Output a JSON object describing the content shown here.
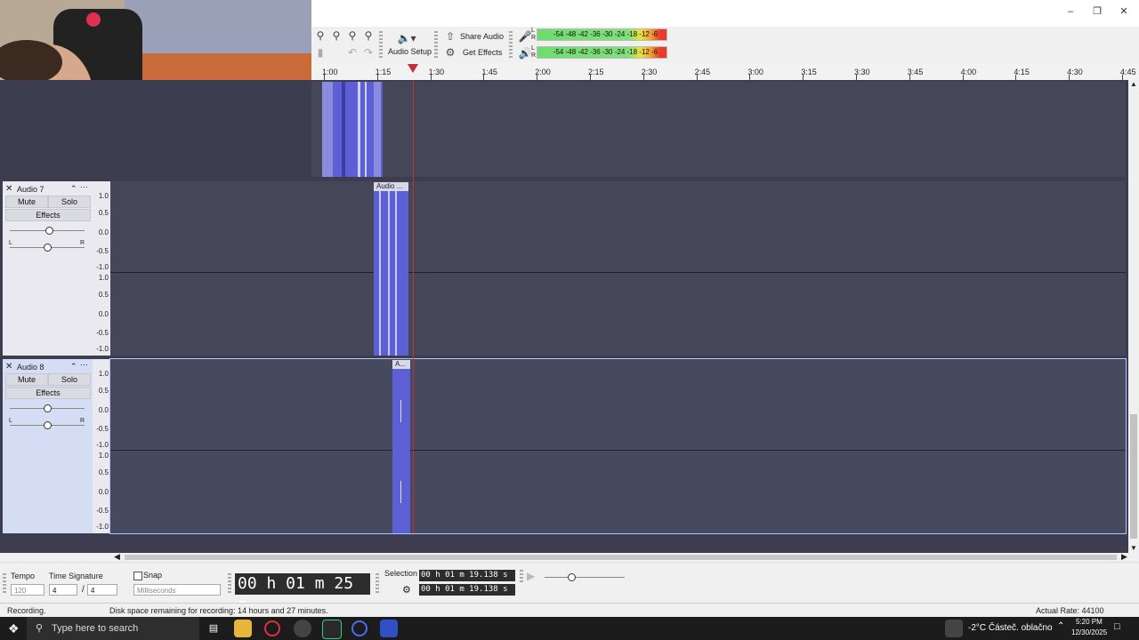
{
  "window": {
    "minimize_icon": "minimize-icon",
    "restore_icon": "restore-icon",
    "close_icon": "close-icon"
  },
  "toolbar": {
    "audio_setup_label": "Audio Setup",
    "share_audio_label": "Share Audio",
    "get_effects_label": "Get Effects",
    "meter_ticks": "-54  -48  -42  -36  -30  -24  -18  -12  -6",
    "meter_l": "L",
    "meter_r": "R"
  },
  "ruler": {
    "ticks": [
      "1:00",
      "1:15",
      "1:30",
      "1:45",
      "2:00",
      "2:15",
      "2:30",
      "2:45",
      "3:00",
      "3:15",
      "3:30",
      "3:45",
      "4:00",
      "4:15",
      "4:30",
      "4:45"
    ]
  },
  "tracks": [
    {
      "name": "Audio 7",
      "mute": "Mute",
      "solo": "Solo",
      "effects": "Effects",
      "clip_label": "Audio ..."
    },
    {
      "name": "Audio 8",
      "mute": "Mute",
      "solo": "Solo",
      "effects": "Effects",
      "clip_label": "A..."
    }
  ],
  "vscale": [
    "1.0",
    "0.5",
    "0.0",
    "-0.5",
    "-1.0"
  ],
  "pan_l": "L",
  "pan_r": "R",
  "bottom": {
    "tempo_label": "Tempo",
    "tempo_value": "120",
    "time_signature_label": "Time Signature",
    "ts_num": "4",
    "ts_sep": "/",
    "ts_den": "4",
    "snap_label": "Snap",
    "snap_unit": "Milliseconds",
    "big_time": "00 h 01 m 25 s",
    "selection_label": "Selection",
    "sel_start": "00 h 01 m 19.138 s",
    "sel_end": "00 h 01 m 19.138 s"
  },
  "status": {
    "left": "Recording.",
    "disk": "Disk space remaining for recording: 14 hours and 27 minutes.",
    "rate": "Actual Rate: 44100"
  },
  "taskbar": {
    "search_placeholder": "Type here to search",
    "weather": "-2°C  Částeč. oblačno",
    "time": "5:20 PM",
    "date": "12/30/2025"
  },
  "colors": {
    "track_bg": "#454758",
    "clip": "#5d5fd4",
    "playhead": "#c0303a"
  }
}
